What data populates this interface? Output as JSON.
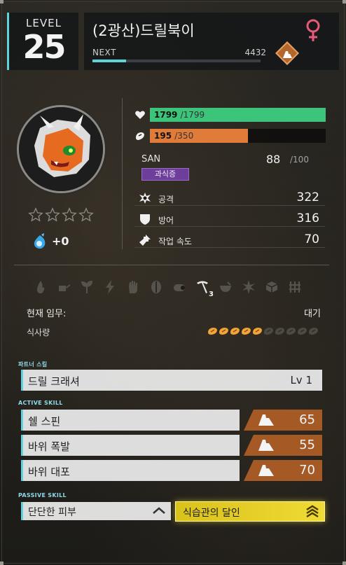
{
  "header": {
    "level_label": "LEVEL",
    "level": "25",
    "pal_name": "(2광산)드릴북이",
    "gender_symbol": "♀",
    "gender_color": "#e85a7a",
    "next_label": "NEXT",
    "next_value": "4432",
    "exp_progress": 0.2
  },
  "status": {
    "hp_value": "1799",
    "hp_max": "/1799",
    "hp_fraction": 1.0,
    "hp_color": "#3cc47a",
    "food_value": "195",
    "food_max": "/350",
    "food_fraction": 0.557,
    "food_color": "#e07b39",
    "san_label": "SAN",
    "san_value": "88",
    "san_max": "/100",
    "trait": "과식증",
    "stars": 0,
    "soul_bonus": "+0"
  },
  "stats": [
    {
      "icon": "attack-icon",
      "label": "공격",
      "value": "322"
    },
    {
      "icon": "defense-icon",
      "label": "방어",
      "value": "316"
    },
    {
      "icon": "work-speed-icon",
      "label": "작업 속도",
      "value": "70"
    }
  ],
  "work": {
    "icons": [
      "kindling",
      "watering",
      "planting",
      "electricity",
      "handiwork",
      "gathering",
      "lumbering",
      "mining",
      "medicine",
      "cooling",
      "transporting",
      "farming"
    ],
    "mining_level": "3",
    "task_label": "현재 임무:",
    "task_value": "대기",
    "food_label": "식사량",
    "food_pips_filled": 5,
    "food_pips_total": 10
  },
  "skills": {
    "partner_label": "파트너 스킬",
    "partner_name": "드릴 크래셔",
    "partner_level": "Lv 1",
    "active_label": "ACTIVE SKILL",
    "active": [
      {
        "name": "쉘 스핀",
        "power": "65"
      },
      {
        "name": "바위 폭발",
        "power": "55"
      },
      {
        "name": "바위 대포",
        "power": "70"
      }
    ],
    "passive_label": "PASSIVE SKILL",
    "passive": [
      {
        "name": "단단한 피부"
      },
      {
        "name": "식습관의 달인"
      }
    ]
  }
}
